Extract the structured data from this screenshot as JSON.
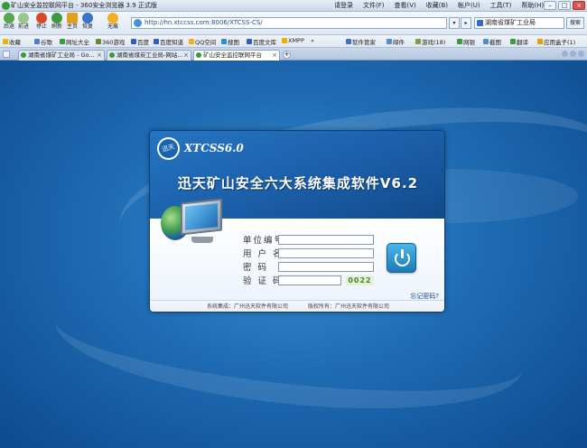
{
  "titlebar": {
    "title": "矿山安全监控联网平台 - 360安全浏览器 3.9 正式版",
    "menus": [
      "请登录",
      "文件(F)",
      "查看(V)",
      "收藏(B)",
      "帐户(U)",
      "工具(T)",
      "帮助(H)"
    ]
  },
  "navbar": {
    "buttons": [
      "后退",
      "前进",
      "停止",
      "刷新",
      "主页",
      "恢复",
      "无痕"
    ],
    "address": "http://hn.xtccss.com:8006/XTCSS-CS/",
    "search_value": "湖南省煤矿工业局",
    "search_button": "搜索"
  },
  "favorites": [
    "收藏",
    "谷歌",
    "网址大全",
    "360游戏",
    "百度",
    "百度知道",
    "QQ空间",
    "搜图",
    "百度文库",
    "XMPP",
    "»"
  ],
  "favorites_right": [
    "软件管家",
    "邮件",
    "游戏(18)",
    "网银",
    "截图",
    "翻译",
    "应用盒子(1)"
  ],
  "tabs": [
    {
      "label": "湖南省煤矿工业局 - Go..."
    },
    {
      "label": "湖南省煤炭工业局-网站..."
    },
    {
      "label": "矿山安全监控联网平台"
    }
  ],
  "login": {
    "brand": "XTCSS6.0",
    "logo_text": "迅天",
    "product_title": "迅天矿山安全六大系统集成软件V6.2",
    "fields": [
      {
        "label": "单位编号",
        "value": ""
      },
      {
        "label": "用 户 名",
        "value": ""
      },
      {
        "label": "密    码",
        "value": ""
      },
      {
        "label": "验 证 码",
        "value": ""
      }
    ],
    "captcha": "0022",
    "forgot": "忘记密码?",
    "footer_left": "系统集成：广州迅天软件有限公司",
    "footer_right": "版权所有：广州迅天软件有限公司"
  },
  "colors": {
    "accent": "#1b5ea8",
    "captcha_text": "#3d8a2d",
    "power": "#2a9ad6"
  }
}
